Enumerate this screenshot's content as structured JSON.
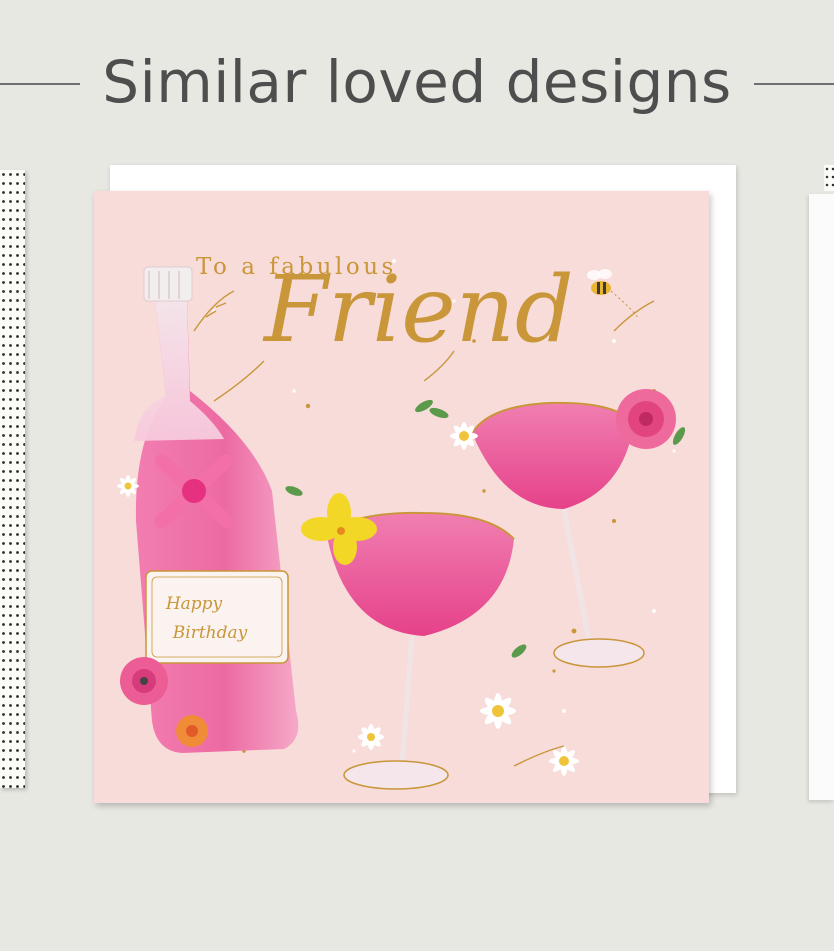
{
  "section": {
    "title": "Similar loved designs"
  },
  "card": {
    "line1": "To a fabulous",
    "line2": "Friend",
    "label_line1": "Happy",
    "label_line2": "Birthday"
  },
  "colors": {
    "background": "#e8e8e3",
    "card_pink": "#f7dcd9",
    "gold": "#c9963a",
    "drink_pink": "#e8488a"
  }
}
